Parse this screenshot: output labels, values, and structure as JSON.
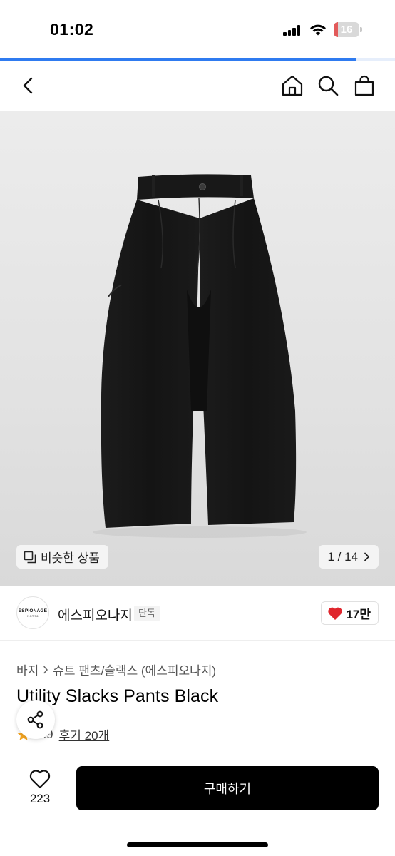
{
  "status_bar": {
    "time": "01:02",
    "battery_level": "16",
    "battery_fill_fraction": 0.16,
    "battery_color": "#e25a5a"
  },
  "load_progress": {
    "fraction": 0.9,
    "color": "#2f7bf0"
  },
  "header": {
    "back_icon": "chevron-left-icon",
    "home_icon": "home-icon",
    "search_icon": "search-icon",
    "bag_icon": "shopping-bag-icon"
  },
  "hero": {
    "image_subject": "black-pants-photo",
    "similar_label": "비슷한 상품",
    "similar_icon": "copy-icon",
    "pager_label": "1 / 14",
    "pager_icon": "chevron-right-icon"
  },
  "brand": {
    "logo_line1": "ESPIONAGE",
    "logo_line2": "NOT'36",
    "name": "에스피오나지",
    "tag": "단독",
    "likes": "17만",
    "like_color": "#e0262d"
  },
  "product": {
    "breadcrumb": [
      "바지",
      "슈트 팬츠/슬랙스 (에스피오나지)"
    ],
    "title": "Utility Slacks Pants Black",
    "rating": "4.9",
    "review_link": "후기 20개",
    "star_color": "#f5a623"
  },
  "bottom_bar": {
    "wish_count": "223",
    "buy_label": "구매하기",
    "buy_color": "#000000"
  }
}
